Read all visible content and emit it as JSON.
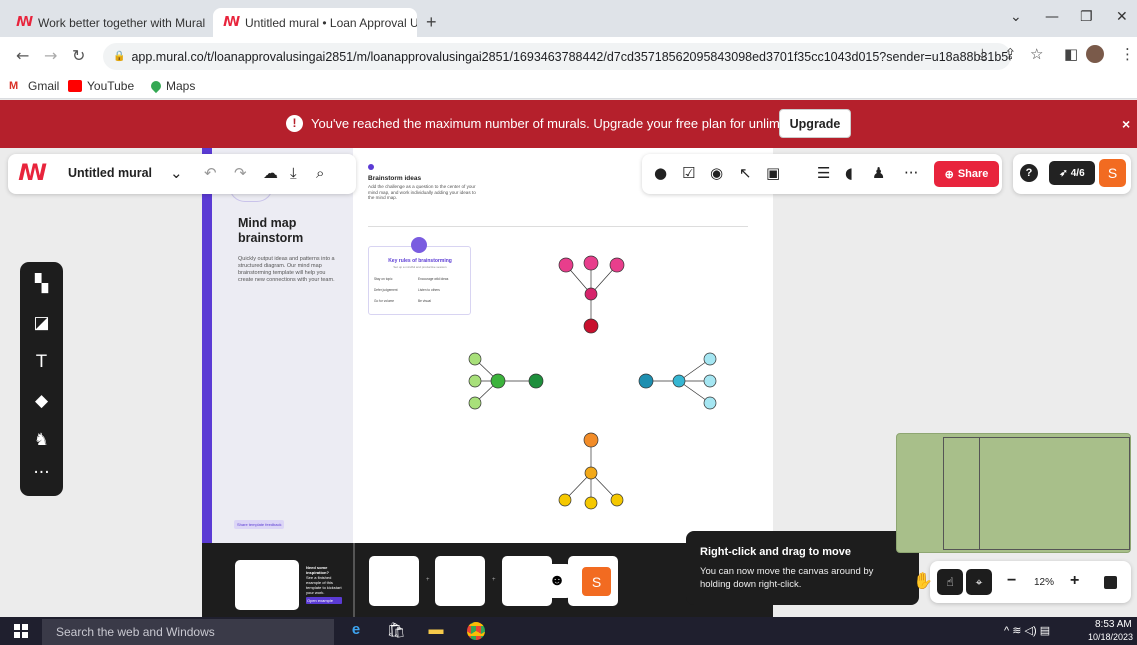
{
  "browser": {
    "tabs": [
      {
        "title": "Work better together with Mural",
        "active": false
      },
      {
        "title": "Untitled mural • Loan Approval U",
        "active": true
      }
    ],
    "url": "app.mural.co/t/loanapprovalusingai2851/m/loanapprovalusingai2851/1693463788442/d7cd35718562095843098ed3701f35cc1043d015?sender=u18a88b31b5c49...",
    "bookmarks": [
      "Gmail",
      "YouTube",
      "Maps"
    ]
  },
  "banner": {
    "message": "You've reached the maximum number of murals. Upgrade your free plan for unlimited murals.",
    "upgrade_label": "Upgrade",
    "close": "×"
  },
  "mural_header": {
    "title": "Untitled mural",
    "share_label": "Share",
    "timer_label": "4/6",
    "help_label": "?",
    "avatar_initial": "S",
    "more": "···"
  },
  "sidebar": {
    "more": "···"
  },
  "template": {
    "title": "Mind map brainstorm",
    "description": "Quickly output ideas and patterns into a structured diagram. Our mind map brainstorming template will help you create new connections with your team.",
    "feedback_link": "Share template feedback",
    "board_title": "Brainstorm ideas",
    "board_description": "Add the challenge as a question to the center of your mind map, and work individually adding your ideas to the mind map.",
    "rules_title": "Key rules of brainstorming",
    "rules_subtitle": "Set up a mindful and productive session",
    "rules": [
      "Stay on topic",
      "Encourage wild ideas",
      "Defer judgement",
      "Listen to others",
      "Go for volume",
      "Be visual"
    ]
  },
  "dock": {
    "inspiration_title": "Need some inspiration?",
    "inspiration_body": "See a finished example of this template to kickstart your work.",
    "inspiration_button": "Open example",
    "presence_initial": "S"
  },
  "tooltip": {
    "title": "Right-click and drag to move",
    "body": "You can now move the canvas around by holding down right-click.",
    "close": "×"
  },
  "zoom": {
    "level": "12%",
    "minus": "−",
    "plus": "+"
  },
  "taskbar": {
    "search_placeholder": "Search the web and Windows",
    "time": "8:53 AM",
    "date": "10/18/2023"
  },
  "colors": {
    "accent_red": "#e8243c",
    "banner_red": "#b5202c",
    "template_purple": "#5b3bd4",
    "pink": "#e83e8c",
    "green": "#3cb33c",
    "teal": "#36b6d2",
    "orange": "#f28c28",
    "yellow": "#f5c800"
  }
}
